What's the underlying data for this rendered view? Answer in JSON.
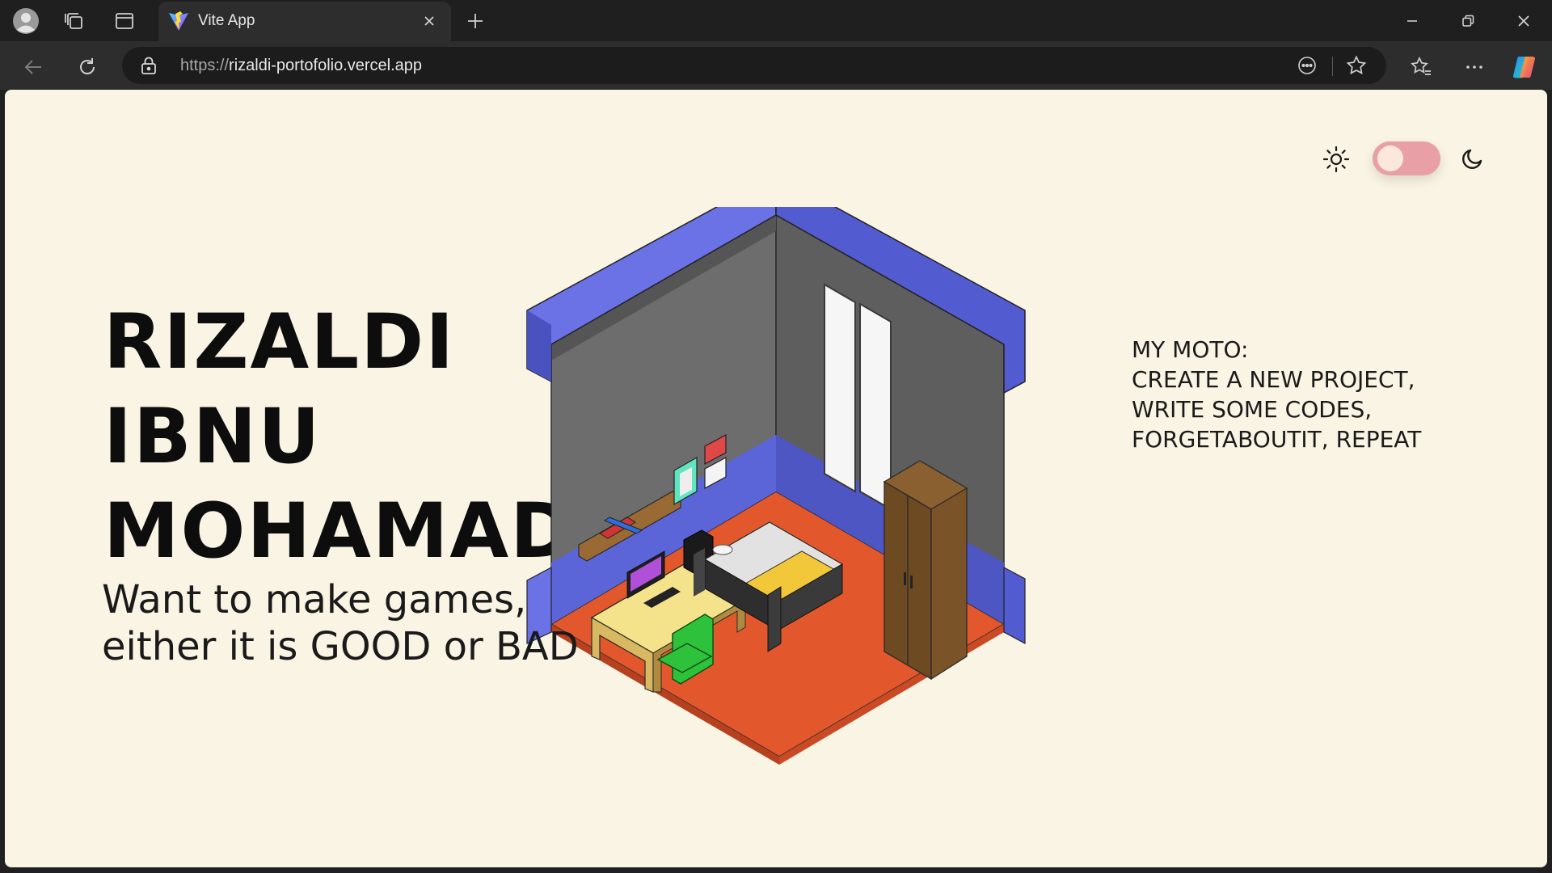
{
  "browser": {
    "tab_title": "Vite App",
    "url_protocol": "https://",
    "url_host": "rizaldi-portofolio.vercel.app"
  },
  "hero": {
    "name_lines": [
      "RIZALDI",
      "IBNU",
      "MOHAMAD"
    ],
    "tagline_lines": [
      "Want to make games,",
      "either it is GOOD or BAD"
    ]
  },
  "moto": {
    "lines": [
      "MY MOTO:",
      "CREATE A NEW PROJECT,",
      "WRITE SOME CODES,",
      "FORGETABOUTIT, REPEAT"
    ]
  },
  "theme": {
    "mode": "light",
    "light_icon": "sun-icon",
    "dark_icon": "moon-icon"
  },
  "colors": {
    "page_bg": "#faf4e4",
    "toggle_track": "#e8a0a6",
    "room_wall_blue": "#6a72e6",
    "room_floor": "#e2582c"
  }
}
